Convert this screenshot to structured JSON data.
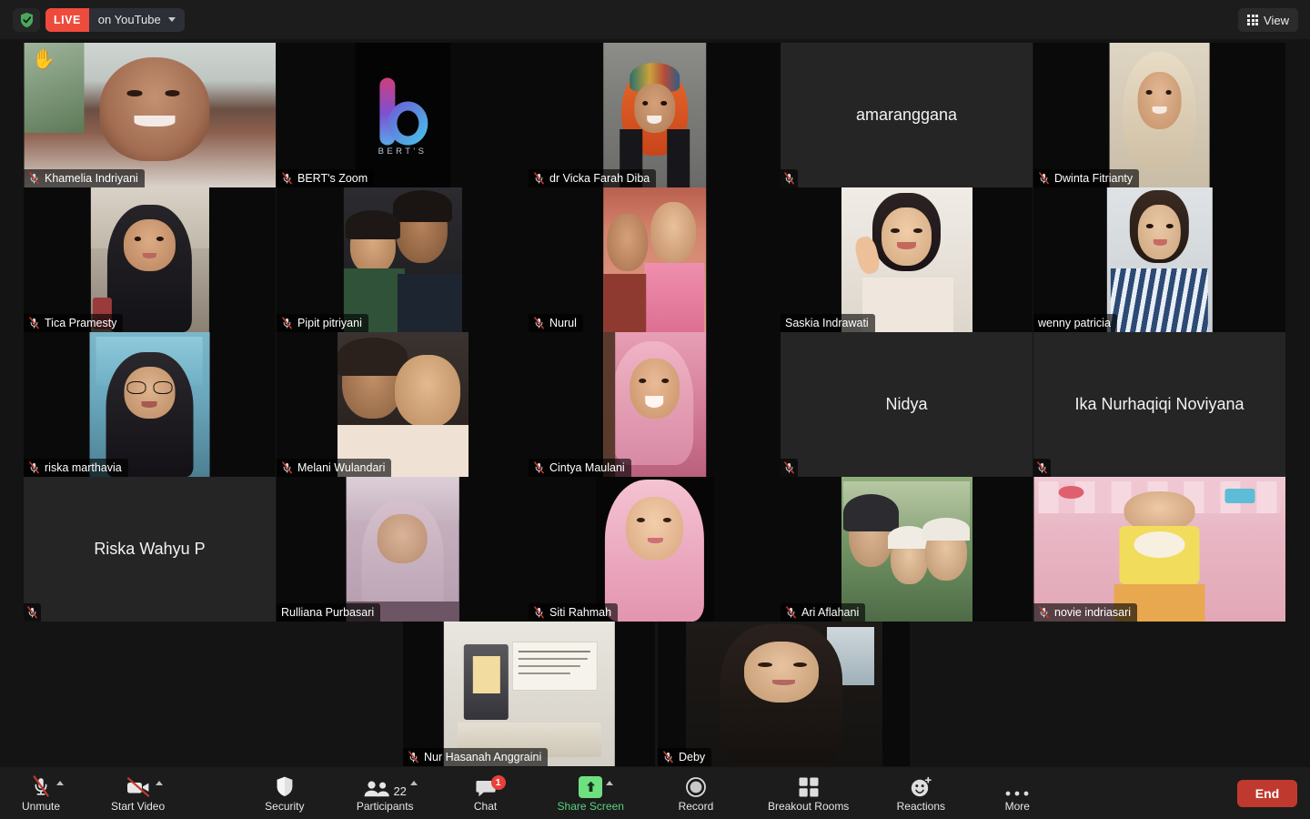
{
  "topbar": {
    "shield_icon": "shield-check-icon",
    "live_badge": "LIVE",
    "live_platform": "on YouTube",
    "dropdown_icon": "chevron-down-icon",
    "view_label": "View",
    "view_icon": "grid-icon"
  },
  "colors": {
    "live_red": "#ee4b3c",
    "speaking_border": "#e6f07a",
    "end_button": "#c0392f",
    "share_green": "#6ee07f",
    "badge_red": "#e8413a",
    "toolbar_bg": "#1c1c1c",
    "app_bg": "#141414"
  },
  "gallery": {
    "columns": 5,
    "rows": 5,
    "participants": [
      {
        "name": "Khamelia Indriyani",
        "muted": true,
        "video": true,
        "hand_raised": true,
        "speaking": false,
        "avatar_text": null,
        "photo": "room-woman-smiling",
        "row": 0,
        "col": 0
      },
      {
        "name": "BERT's Zoom",
        "muted": true,
        "video": true,
        "hand_raised": false,
        "speaking": false,
        "avatar_text": null,
        "photo": "berts-logo",
        "row": 0,
        "col": 1
      },
      {
        "name": "dr Vicka Farah Diba",
        "muted": true,
        "video": true,
        "hand_raised": false,
        "speaking": true,
        "avatar_text": null,
        "photo": "orange-hijab-woman",
        "row": 0,
        "col": 2
      },
      {
        "name": "",
        "muted": true,
        "video": false,
        "hand_raised": false,
        "speaking": false,
        "avatar_text": "amaranggana",
        "photo": null,
        "row": 0,
        "col": 3
      },
      {
        "name": "Dwinta Fitrianty",
        "muted": true,
        "video": true,
        "hand_raised": false,
        "speaking": false,
        "avatar_text": null,
        "photo": "cream-hijab-woman",
        "row": 0,
        "col": 4
      },
      {
        "name": "Tica Pramesty",
        "muted": true,
        "video": true,
        "hand_raised": false,
        "speaking": false,
        "avatar_text": null,
        "photo": "black-hijab-woman",
        "row": 1,
        "col": 0
      },
      {
        "name": "Pipit pitriyani",
        "muted": true,
        "video": true,
        "hand_raised": false,
        "speaking": false,
        "avatar_text": null,
        "photo": "mother-and-child",
        "row": 1,
        "col": 1
      },
      {
        "name": "Nurul",
        "muted": true,
        "video": true,
        "hand_raised": false,
        "speaking": false,
        "avatar_text": null,
        "photo": "two-children-pink",
        "row": 1,
        "col": 2
      },
      {
        "name": "Saskia Indrawati",
        "muted": false,
        "video": true,
        "hand_raised": false,
        "speaking": false,
        "avatar_text": null,
        "photo": "woman-peace-sign",
        "row": 1,
        "col": 3
      },
      {
        "name": "wenny patricia",
        "muted": false,
        "video": true,
        "hand_raised": false,
        "speaking": false,
        "avatar_text": null,
        "photo": "striped-shirt-woman",
        "row": 1,
        "col": 4
      },
      {
        "name": "riska marthavia",
        "muted": true,
        "video": true,
        "hand_raised": false,
        "speaking": false,
        "avatar_text": null,
        "photo": "glasses-hijab-woman",
        "row": 2,
        "col": 0
      },
      {
        "name": "Melani Wulandari",
        "muted": true,
        "video": true,
        "hand_raised": false,
        "speaking": false,
        "avatar_text": null,
        "photo": "mother-with-baby",
        "row": 2,
        "col": 1
      },
      {
        "name": "Cintya Maulani",
        "muted": true,
        "video": true,
        "hand_raised": false,
        "speaking": false,
        "avatar_text": null,
        "photo": "pink-hijab-woman",
        "row": 2,
        "col": 2
      },
      {
        "name": "",
        "muted": true,
        "video": false,
        "hand_raised": false,
        "speaking": false,
        "avatar_text": "Nidya",
        "photo": null,
        "row": 2,
        "col": 3
      },
      {
        "name": "",
        "muted": true,
        "video": false,
        "hand_raised": false,
        "speaking": false,
        "avatar_text": "Ika Nurhaqiqi Noviyana",
        "photo": null,
        "row": 2,
        "col": 4
      },
      {
        "name": "",
        "muted": true,
        "video": false,
        "hand_raised": false,
        "speaking": false,
        "avatar_text": "Riska Wahyu P",
        "photo": null,
        "row": 3,
        "col": 0
      },
      {
        "name": "Rulliana Purbasari",
        "muted": false,
        "video": true,
        "hand_raised": false,
        "speaking": false,
        "avatar_text": null,
        "photo": "lilac-hijab-woman",
        "row": 3,
        "col": 1
      },
      {
        "name": "Siti Rahmah",
        "muted": true,
        "video": true,
        "hand_raised": false,
        "speaking": false,
        "avatar_text": null,
        "photo": "pink-hijab-portrait",
        "row": 3,
        "col": 2
      },
      {
        "name": "Ari Aflahani",
        "muted": true,
        "video": true,
        "hand_raised": false,
        "speaking": false,
        "avatar_text": null,
        "photo": "family-group-photo",
        "row": 3,
        "col": 3
      },
      {
        "name": "novie indriasari",
        "muted": true,
        "video": true,
        "hand_raised": false,
        "speaking": false,
        "avatar_text": null,
        "photo": "toddler-overalls",
        "row": 3,
        "col": 4
      },
      {
        "name": "Nur Hasanah Anggraini",
        "muted": true,
        "video": true,
        "hand_raised": false,
        "speaking": false,
        "avatar_text": null,
        "photo": "lantern-book-quote",
        "row": 4,
        "col": 0
      },
      {
        "name": "Deby",
        "muted": true,
        "video": true,
        "hand_raised": false,
        "speaking": false,
        "avatar_text": null,
        "photo": "long-hair-woman",
        "row": 4,
        "col": 1
      }
    ]
  },
  "toolbar": {
    "items": [
      {
        "id": "audio",
        "label": "Unmute",
        "icon": "microphone-muted-icon",
        "arrow": true,
        "badge": null,
        "count": null,
        "green": false
      },
      {
        "id": "video",
        "label": "Start Video",
        "icon": "camera-muted-icon",
        "arrow": true,
        "badge": null,
        "count": null,
        "green": false
      },
      {
        "id": "security",
        "label": "Security",
        "icon": "shield-icon",
        "arrow": false,
        "badge": null,
        "count": null,
        "green": false
      },
      {
        "id": "participants",
        "label": "Participants",
        "icon": "people-icon",
        "arrow": true,
        "badge": null,
        "count": "22",
        "green": false
      },
      {
        "id": "chat",
        "label": "Chat",
        "icon": "chat-bubble-icon",
        "arrow": false,
        "badge": "1",
        "count": null,
        "green": false
      },
      {
        "id": "share",
        "label": "Share Screen",
        "icon": "share-screen-icon",
        "arrow": true,
        "badge": null,
        "count": null,
        "green": true
      },
      {
        "id": "record",
        "label": "Record",
        "icon": "record-circle-icon",
        "arrow": false,
        "badge": null,
        "count": null,
        "green": false
      },
      {
        "id": "breakout",
        "label": "Breakout Rooms",
        "icon": "breakout-rooms-icon",
        "arrow": false,
        "badge": null,
        "count": null,
        "green": false
      },
      {
        "id": "reactions",
        "label": "Reactions",
        "icon": "reactions-smiley-icon",
        "arrow": false,
        "badge": null,
        "count": null,
        "green": false
      },
      {
        "id": "more",
        "label": "More",
        "icon": "ellipsis-icon",
        "arrow": false,
        "badge": null,
        "count": null,
        "green": false
      }
    ],
    "end_label": "End"
  }
}
